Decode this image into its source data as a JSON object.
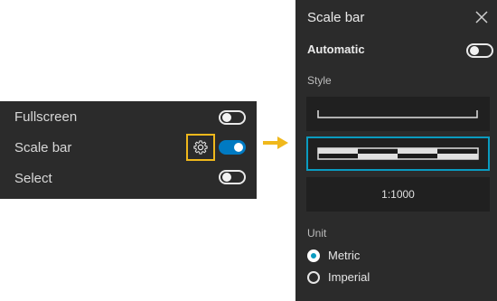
{
  "left_panel": {
    "rows": [
      {
        "label": "Fullscreen",
        "enabled": false
      },
      {
        "label": "Scale bar",
        "enabled": true
      },
      {
        "label": "Select",
        "enabled": false
      }
    ]
  },
  "settings_panel": {
    "title": "Scale bar",
    "automatic_label": "Automatic",
    "automatic_enabled": false,
    "style_label": "Style",
    "style_options": [
      "line",
      "alternating",
      "ratio"
    ],
    "selected_style": "alternating",
    "ratio_text": "1:1000",
    "unit_label": "Unit",
    "units": [
      {
        "label": "Metric",
        "checked": true
      },
      {
        "label": "Imperial",
        "checked": false
      }
    ]
  },
  "colors": {
    "panel_bg": "#2b2b2b",
    "toggle_on": "#007ac2",
    "highlight": "#f0b81c",
    "selected_border": "#0a9bc0"
  },
  "icons": [
    "gear-icon",
    "arrow-right-icon",
    "close-icon"
  ]
}
